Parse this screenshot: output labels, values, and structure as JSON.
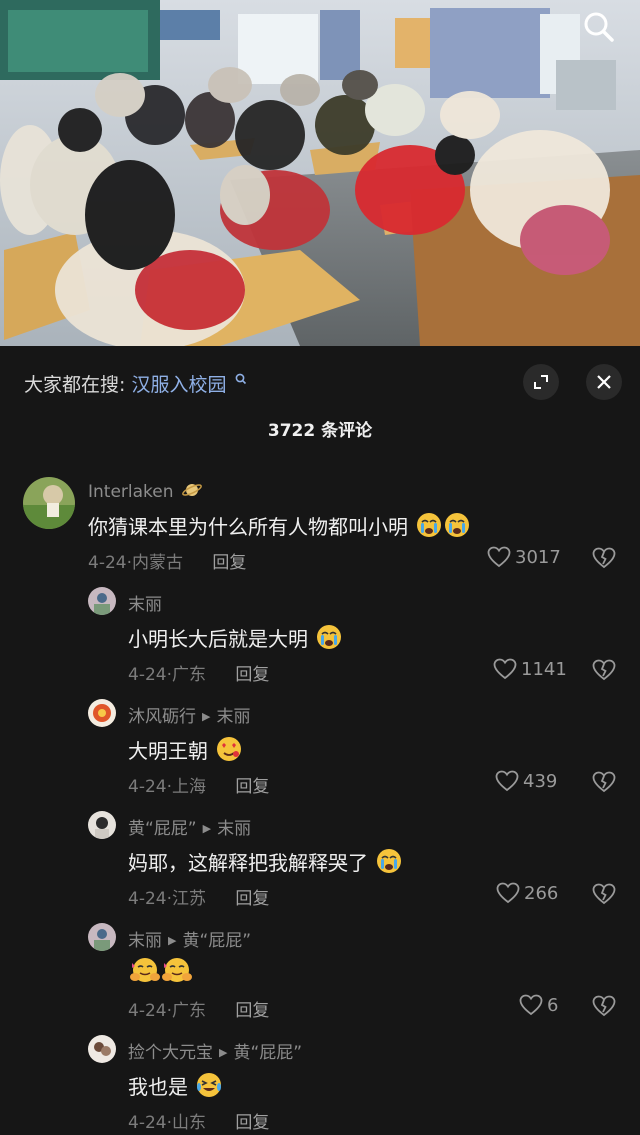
{
  "header": {
    "trending_prefix": "大家都在搜:",
    "trending_keyword": "汉服入校园",
    "comment_count": "3722 条评论"
  },
  "icons": {
    "photo_search": "search-icon",
    "expand": "expand-icon",
    "close": "close-icon",
    "like": "heart-outline-icon",
    "dislike": "broken-heart-icon"
  },
  "colors": {
    "background": "#161616",
    "keyword_link": "#8fb0e6"
  },
  "comments": [
    {
      "user": "Interlaken",
      "text": "你猜课本里为什么所有人物都叫小明",
      "emoji": [
        "crying-face",
        "crying-face"
      ],
      "date": "4-24",
      "location": "内蒙古",
      "reply_label": "回复",
      "likes": "3017"
    },
    {
      "user": "末丽",
      "reply_to": "",
      "text": "小明长大后就是大明",
      "emoji": [
        "crying-face"
      ],
      "date": "4-24",
      "location": "广东",
      "reply_label": "回复",
      "likes": "1141"
    },
    {
      "user": "沐风砺行",
      "reply_to": "末丽",
      "text": "大明王朝",
      "emoji": [
        "heart-eyes-face"
      ],
      "date": "4-24",
      "location": "上海",
      "reply_label": "回复",
      "likes": "439"
    },
    {
      "user": "黄“屁屁”",
      "reply_to": "末丽",
      "text": "妈耶，这解释把我解释哭了",
      "emoji": [
        "crying-face"
      ],
      "date": "4-24",
      "location": "江苏",
      "reply_label": "回复",
      "likes": "266"
    },
    {
      "user": "末丽",
      "reply_to": "黄“屁屁”",
      "text": "",
      "emoji": [
        "hugging-face",
        "hugging-face"
      ],
      "date": "4-24",
      "location": "广东",
      "reply_label": "回复",
      "likes": "6"
    },
    {
      "user": "捡个大元宝",
      "reply_to": "黄“屁屁”",
      "text": "我也是",
      "emoji": [
        "laughing-tears-face"
      ],
      "date": "4-24",
      "location": "山东",
      "reply_label": "回复",
      "likes": ""
    }
  ]
}
